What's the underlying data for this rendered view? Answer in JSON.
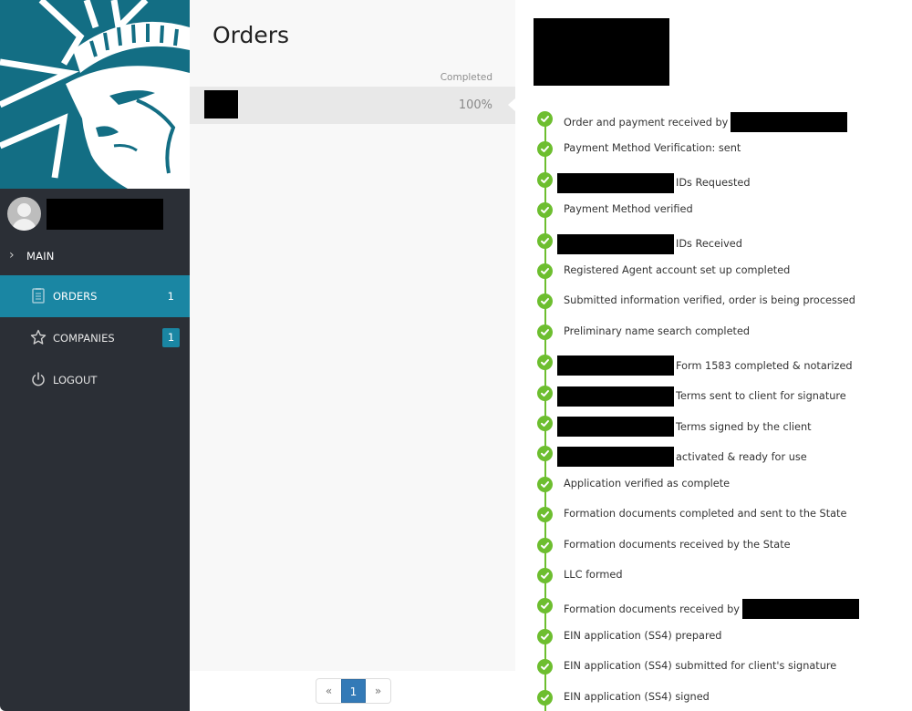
{
  "sidebar": {
    "brand_color": "#136e84",
    "user": {
      "name": "[redacted]"
    },
    "section": {
      "label": "MAIN",
      "icon": "chevron-right-icon"
    },
    "items": [
      {
        "label": "ORDERS",
        "icon": "clipboard-list-icon",
        "count": "1",
        "active": true
      },
      {
        "label": "COMPANIES",
        "icon": "star-icon",
        "count": "1",
        "active": false
      },
      {
        "label": "LOGOUT",
        "icon": "power-icon",
        "active": false
      }
    ]
  },
  "orders": {
    "title": "Orders",
    "column_header": "Completed",
    "rows": [
      {
        "name": "[redacted]",
        "completed": "100%"
      }
    ],
    "pagination": {
      "prev": "«",
      "current": "1",
      "next": "»"
    }
  },
  "detail": {
    "title": "[redacted]",
    "accent_color": "#6dbe2f",
    "steps": [
      {
        "text": "Order and payment received by",
        "redact": "after"
      },
      {
        "text": "Payment Method Verification: sent"
      },
      {
        "text": "IDs Requested",
        "redact": "before"
      },
      {
        "text": "Payment Method verified"
      },
      {
        "text": "IDs Received",
        "redact": "before"
      },
      {
        "text": "Registered Agent account set up completed"
      },
      {
        "text": "Submitted information verified, order is being processed"
      },
      {
        "text": "Preliminary name search completed"
      },
      {
        "text": "Form 1583 completed & notarized",
        "redact": "before"
      },
      {
        "text": "Terms sent to client for signature",
        "redact": "before"
      },
      {
        "text": "Terms signed by the client",
        "redact": "before"
      },
      {
        "text": "activated & ready for use",
        "redact": "before"
      },
      {
        "text": "Application verified as complete"
      },
      {
        "text": "Formation documents completed and sent to the State"
      },
      {
        "text": "Formation documents received by the State"
      },
      {
        "text": "LLC formed"
      },
      {
        "text": "Formation documents received by",
        "redact": "after"
      },
      {
        "text": "EIN application (SS4) prepared"
      },
      {
        "text": "EIN application (SS4) submitted for client's signature"
      },
      {
        "text": "EIN application (SS4) signed"
      }
    ]
  }
}
